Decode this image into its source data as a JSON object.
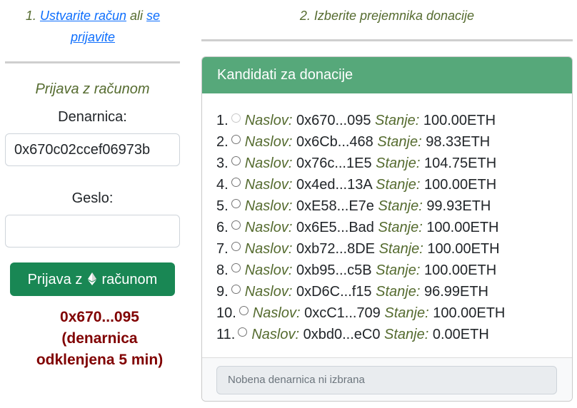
{
  "step1": {
    "num": "1.",
    "create_link": "Ustvarite račun",
    "or": "ali",
    "login_link_1": "se",
    "login_link_2": "prijavite"
  },
  "step2": {
    "text": "2. Izberite prejemnika donacije"
  },
  "login": {
    "title": "Prijava z računom",
    "wallet_label": "Denarnica:",
    "wallet_value": "0x670c02ccef06973b",
    "password_label": "Geslo:",
    "password_value": "",
    "button_before": "Prijava z",
    "button_after": "računom",
    "button_icon": "ethereum-icon",
    "status_line1": "0x670...095",
    "status_line2": "(denarnica",
    "status_line3": "odklenjena 5 min)"
  },
  "donation": {
    "header": "Kandidati za donacije",
    "address_label": "Naslov:",
    "balance_label": "Stanje:",
    "candidates": [
      {
        "num": "1.",
        "address": "0x670...095",
        "balance": "100.00ETH",
        "disabled": true
      },
      {
        "num": "2.",
        "address": "0x6Cb...468",
        "balance": "98.33ETH"
      },
      {
        "num": "3.",
        "address": "0x76c...1E5",
        "balance": "104.75ETH"
      },
      {
        "num": "4.",
        "address": "0x4ed...13A",
        "balance": "100.00ETH"
      },
      {
        "num": "5.",
        "address": "0xE58...E7e",
        "balance": "99.93ETH"
      },
      {
        "num": "6.",
        "address": "0x6E5...Bad",
        "balance": "100.00ETH"
      },
      {
        "num": "7.",
        "address": "0xb72...8DE",
        "balance": "100.00ETH"
      },
      {
        "num": "8.",
        "address": "0xb95...c5B",
        "balance": "100.00ETH"
      },
      {
        "num": "9.",
        "address": "0xD6C...f15",
        "balance": "96.99ETH"
      },
      {
        "num": "10.",
        "address": "0xcC1...709",
        "balance": "100.00ETH"
      },
      {
        "num": "11.",
        "address": "0xbd0...eC0",
        "balance": "0.00ETH"
      }
    ],
    "selected_text": "Nobena denarnica ni izbrana"
  },
  "colors": {
    "accent": "#56a87a",
    "button": "#198754",
    "label": "#556b2f",
    "status": "#800000",
    "link": "#0d6efd"
  }
}
